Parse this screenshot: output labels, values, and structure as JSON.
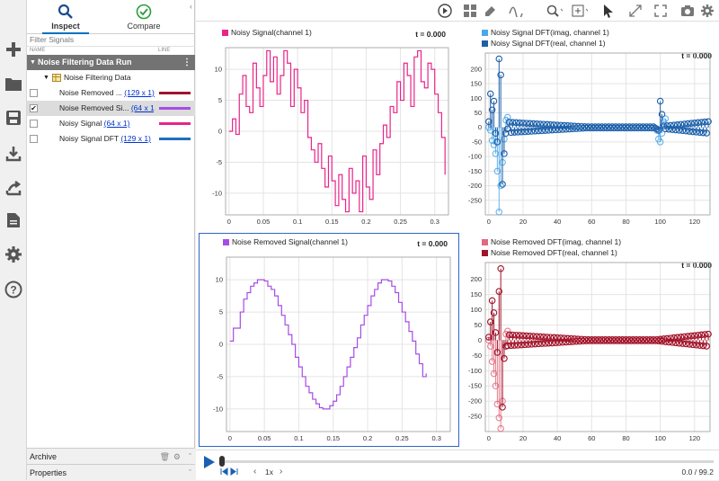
{
  "left_toolbar": {
    "icons": [
      "plus-icon",
      "folder-icon",
      "save-icon",
      "download-icon",
      "share-icon",
      "report-icon",
      "gear-icon",
      "help-icon"
    ]
  },
  "tabs": [
    {
      "label": "Inspect",
      "active": true
    },
    {
      "label": "Compare",
      "active": false
    }
  ],
  "filter_placeholder": "Filter Signals",
  "table_header": {
    "name": "NAME",
    "line": "LINE"
  },
  "run": {
    "label": "Noise Filtering Data Run"
  },
  "group": {
    "label": "Noise Filtering Data"
  },
  "signals": [
    {
      "name": "Noise Removed ...",
      "size": "(129 x 1)",
      "checked": false,
      "color": "#a0142a",
      "selected": false
    },
    {
      "name": "Noise Removed Si...",
      "size": "(64 x 1)",
      "checked": true,
      "color": "#a64ce8",
      "selected": true
    },
    {
      "name": "Noisy Signal",
      "size": "(64 x 1)",
      "checked": false,
      "color": "#e8258a",
      "selected": false
    },
    {
      "name": "Noisy Signal DFT",
      "size": "(129 x 1)",
      "checked": false,
      "color": "#1f6fbf",
      "selected": false
    }
  ],
  "archive": {
    "label": "Archive"
  },
  "properties": {
    "label": "Properties"
  },
  "playback": {
    "speed": "1x",
    "time": "0.0 / 99.2",
    "progress": 0.0
  },
  "colors": {
    "pink": "#e8258a",
    "purple": "#a64ce8",
    "lightblue": "#4da6e8",
    "darkblue": "#1f5fa8",
    "lightred": "#e06a7e",
    "darkred": "#a0142a"
  },
  "plots": [
    {
      "id": "tl",
      "title": "Noisy Signal(channel 1)",
      "time": "t = 0.000",
      "xticks": [
        "0",
        "0.05",
        "0.1",
        "0.15",
        "0.2",
        "0.25",
        "0.3"
      ],
      "yticks": [
        "10",
        "5",
        "0",
        "-5",
        "-10"
      ],
      "legend": [
        {
          "label": "Noisy Signal(channel 1)",
          "color": "#e8258a"
        }
      ]
    },
    {
      "id": "tr",
      "title": "",
      "time": "t = 0.000",
      "xticks": [
        "0",
        "20",
        "40",
        "60",
        "80",
        "100",
        "120"
      ],
      "yticks": [
        "200",
        "150",
        "100",
        "50",
        "0",
        "-50",
        "-100",
        "-150",
        "-200",
        "-250"
      ],
      "legend": [
        {
          "label": "Noisy Signal DFT(imag, channel 1)",
          "color": "#4da6e8"
        },
        {
          "label": "Noisy Signal DFT(real, channel 1)",
          "color": "#1f5fa8"
        }
      ]
    },
    {
      "id": "bl",
      "title": "Noise Removed Signal(channel 1)",
      "time": "t = 0.000",
      "xticks": [
        "0",
        "0.05",
        "0.1",
        "0.15",
        "0.2",
        "0.25",
        "0.3"
      ],
      "yticks": [
        "10",
        "5",
        "0",
        "-5",
        "-10"
      ],
      "legend": [
        {
          "label": "Noise Removed Signal(channel 1)",
          "color": "#a64ce8"
        }
      ]
    },
    {
      "id": "br",
      "title": "",
      "time": "t = 0.000",
      "xticks": [
        "0",
        "20",
        "40",
        "60",
        "80",
        "100",
        "120"
      ],
      "yticks": [
        "200",
        "150",
        "100",
        "50",
        "0",
        "-50",
        "-100",
        "-150",
        "-200",
        "-250"
      ],
      "legend": [
        {
          "label": "Noise Removed DFT(imag, channel 1)",
          "color": "#e06a7e"
        },
        {
          "label": "Noise Removed DFT(real, channel 1)",
          "color": "#a0142a"
        }
      ]
    }
  ]
}
